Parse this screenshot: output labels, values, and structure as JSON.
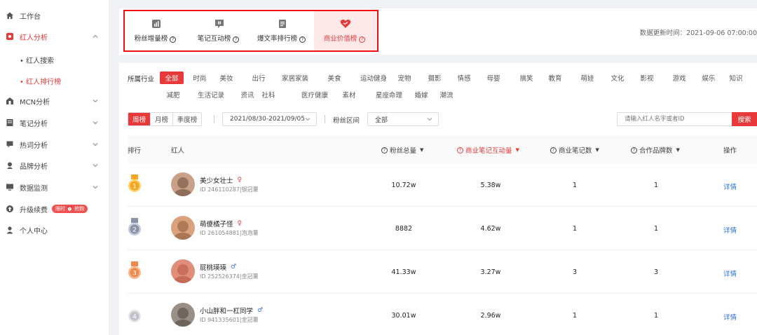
{
  "sidebar": {
    "items": [
      {
        "label": "工作台",
        "icon": "home-icon"
      },
      {
        "label": "红人分析",
        "icon": "gear-icon"
      },
      {
        "label": "MCN分析",
        "icon": "building-icon"
      },
      {
        "label": "笔记分析",
        "icon": "notebook-icon"
      },
      {
        "label": "热词分析",
        "icon": "chat-icon"
      },
      {
        "label": "品牌分析",
        "icon": "brand-icon"
      },
      {
        "label": "数据监测",
        "icon": "monitor-icon"
      },
      {
        "label": "升级续费",
        "icon": "upgrade-icon"
      },
      {
        "label": "个人中心",
        "icon": "user-icon"
      }
    ],
    "subitems": [
      "• 红人搜索",
      "• 红人排行榜"
    ],
    "upgrade_badge": "限时 ⏰ 抢购"
  },
  "rank_tabs": [
    {
      "label": "粉丝增量榜"
    },
    {
      "label": "笔记互动榜"
    },
    {
      "label": "爆文率排行榜"
    },
    {
      "label": "商业价值榜"
    }
  ],
  "update_time": "数据更新时间：2021-09-06 07:00:00",
  "filters": {
    "label": "所属行业",
    "row1": [
      "全部",
      "时尚",
      "美妆",
      "出行",
      "家居家装",
      "美食",
      "运动健身",
      "宠物",
      "摄影",
      "情感",
      "母婴",
      "搞笑",
      "教育",
      "萌娃",
      "文化",
      "影视",
      "游戏",
      "娱乐",
      "知识"
    ],
    "row2": [
      "减肥",
      "生活记录",
      "资讯",
      "社科",
      "医疗健康",
      "素材",
      "星座命理",
      "婚嫁",
      "潮流"
    ]
  },
  "period_tabs": [
    "周榜",
    "月榜",
    "季度榜"
  ],
  "date_range": "2021/08/30-2021/09/05",
  "fans_label": "粉丝区间",
  "fans_select": "全部",
  "search": {
    "placeholder": "请输入红人名字或者ID",
    "button": "搜索"
  },
  "table": {
    "headers": {
      "rank": "排行",
      "kol": "红人",
      "fans": "粉丝总量",
      "interact": "商业笔记互动量",
      "notes": "商业笔记数",
      "brands": "合作品牌数",
      "action": "操作"
    },
    "rows": [
      {
        "rank": "1",
        "name": "美少女壮士",
        "gender": "♀",
        "id": "ID 246110287|铜冠薯",
        "fans": "10.72w",
        "interact": "5.38w",
        "notes": "1",
        "brands": "1",
        "action": "详情"
      },
      {
        "rank": "2",
        "name": "萌傻橘子怪",
        "gender": "♀",
        "id": "ID 261054881|泡泡薯",
        "fans": "8882",
        "interact": "4.62w",
        "notes": "1",
        "brands": "1",
        "action": "详情"
      },
      {
        "rank": "3",
        "name": "屁桃瑛瑛",
        "gender": "♂",
        "id": "ID 252526374|金冠薯",
        "fans": "41.33w",
        "interact": "3.27w",
        "notes": "3",
        "brands": "3",
        "action": "详情"
      },
      {
        "rank": "4",
        "name": "小山胖和一杠同学",
        "gender": "♂",
        "id": "ID 941335601|金冠薯",
        "fans": "30.01w",
        "interact": "2.96w",
        "notes": "1",
        "brands": "1",
        "action": "详情"
      }
    ]
  },
  "colors": {
    "accent": "#e83a3a",
    "link": "#2f6fe0",
    "female": "#e83a3a",
    "male": "#2f6fe0"
  }
}
